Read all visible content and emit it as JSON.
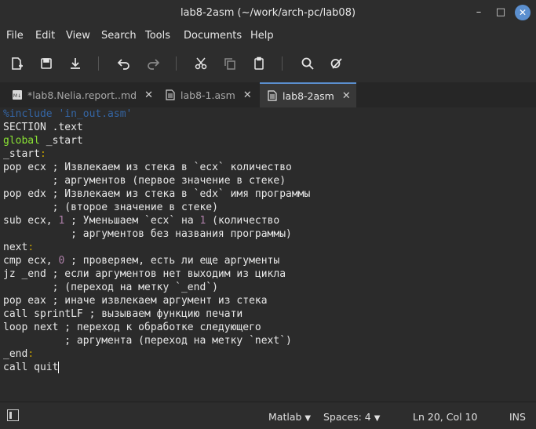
{
  "window": {
    "title": "lab8-2asm (~/work/arch-pc/lab08)"
  },
  "menu": [
    "File",
    "Edit",
    "View",
    "Search",
    "Tools",
    "Documents",
    "Help"
  ],
  "toolbar": {
    "icons": [
      "new-document-icon",
      "save-icon",
      "download-icon",
      "undo-icon",
      "redo-icon",
      "cut-icon",
      "copy-icon",
      "paste-icon",
      "search-icon",
      "edit-replace-icon"
    ]
  },
  "tabs": [
    {
      "label": "*lab8.Nelia.report..md",
      "icon": "markdown-file-icon"
    },
    {
      "label": "lab8-1.asm",
      "icon": "text-file-icon"
    },
    {
      "label": "lab8-2asm",
      "icon": "text-file-icon"
    }
  ],
  "editor": {
    "lines": [
      "%include 'in_out.asm'",
      "SECTION .text",
      "global _start",
      "_start:",
      "pop ecx ; Извлекаем из стека в `ecx` количество",
      "        ; аргументов (первое значение в стеке)",
      "pop edx ; Извлекаем из стека в `edx` имя программы",
      "        ; (второе значение в стеке)",
      "sub ecx, 1 ; Уменьшаем `ecx` на 1 (количество",
      "           ; аргументов без названия программы)",
      "next:",
      "cmp ecx, 0 ; проверяем, есть ли еще аргументы",
      "jz _end ; если аргументов нет выходим из цикла",
      "        ; (переход на метку `_end`)",
      "pop eax ; иначе извлекаем аргумент из стека",
      "call sprintLF ; вызываем функцию печати",
      "loop next ; переход к обработке следующего",
      "          ; аргумента (переход на метку `next`)",
      "_end:",
      "call quit"
    ]
  },
  "status": {
    "language": "Matlab",
    "spaces": "Spaces: 4",
    "position": "Ln 20, Col 10",
    "mode": "INS"
  }
}
